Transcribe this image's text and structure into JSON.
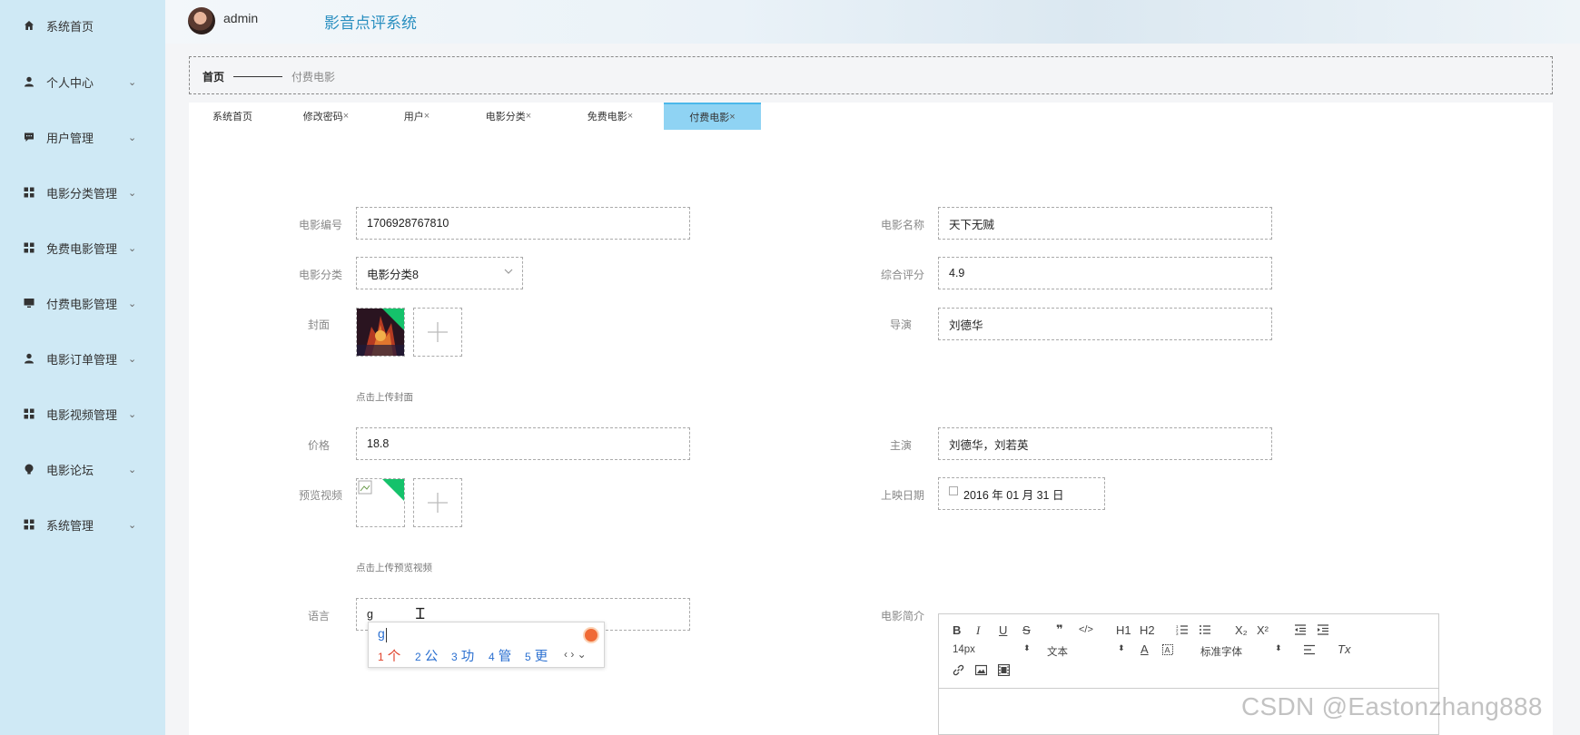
{
  "sidebar": {
    "items": [
      {
        "label": "系统首页",
        "icon": "home-icon",
        "has_chevron": false
      },
      {
        "label": "个人中心",
        "icon": "user-icon",
        "has_chevron": true
      },
      {
        "label": "用户管理",
        "icon": "chat-icon",
        "has_chevron": true
      },
      {
        "label": "电影分类管理",
        "icon": "grid-icon",
        "has_chevron": true
      },
      {
        "label": "免费电影管理",
        "icon": "grid-icon",
        "has_chevron": true
      },
      {
        "label": "付费电影管理",
        "icon": "monitor-icon",
        "has_chevron": true
      },
      {
        "label": "电影订单管理",
        "icon": "user-icon",
        "has_chevron": true
      },
      {
        "label": "电影视频管理",
        "icon": "grid-icon",
        "has_chevron": true
      },
      {
        "label": "电影论坛",
        "icon": "bulb-icon",
        "has_chevron": true
      },
      {
        "label": "系统管理",
        "icon": "grid-icon",
        "has_chevron": true
      }
    ],
    "chevron": "⌄"
  },
  "header": {
    "username": "admin",
    "system_title": "影音点评系统"
  },
  "breadcrumb": {
    "home": "首页",
    "current": "付费电影"
  },
  "tabs": [
    {
      "label": "系统首页",
      "closable": false,
      "active": false
    },
    {
      "label": "修改密码",
      "closable": true,
      "active": false
    },
    {
      "label": "用户",
      "closable": true,
      "active": false
    },
    {
      "label": "电影分类",
      "closable": true,
      "active": false
    },
    {
      "label": "免费电影",
      "closable": true,
      "active": false
    },
    {
      "label": "付费电影",
      "closable": true,
      "active": true
    }
  ],
  "tab_close": "×",
  "form": {
    "movie_no": {
      "label": "电影编号",
      "value": "1706928767810"
    },
    "movie_name": {
      "label": "电影名称",
      "value": "天下无贼"
    },
    "category": {
      "label": "电影分类",
      "value": "电影分类8"
    },
    "rating": {
      "label": "综合评分",
      "value": "4.9"
    },
    "cover": {
      "label": "封面",
      "hint": "点击上传封面"
    },
    "director": {
      "label": "导演",
      "value": "刘德华"
    },
    "price": {
      "label": "价格",
      "value": "18.8"
    },
    "actors": {
      "label": "主演",
      "value": "刘德华，刘若英"
    },
    "preview_video": {
      "label": "预览视频",
      "hint": "点击上传预览视频"
    },
    "release_date": {
      "label": "上映日期",
      "value": "2016 年 01 月 31 日"
    },
    "language": {
      "label": "语言",
      "value": "g"
    },
    "intro": {
      "label": "电影简介"
    }
  },
  "ime": {
    "composition": "g",
    "candidates": [
      {
        "num": "1",
        "char": "个"
      },
      {
        "num": "2",
        "char": "公"
      },
      {
        "num": "3",
        "char": "功"
      },
      {
        "num": "4",
        "char": "管"
      },
      {
        "num": "5",
        "char": "更"
      }
    ],
    "nav": "‹ › ⌄"
  },
  "editor": {
    "font_size": "14px",
    "text_type": "文本",
    "font_family": "标准字体",
    "buttons": [
      "B",
      "I",
      "U",
      "S",
      "❞",
      "</>",
      "H1",
      "H2",
      "list-ordered",
      "list-bullet",
      "X₂",
      "X²",
      "outdent",
      "indent",
      "A",
      "A-bg",
      "align",
      "Tx",
      "link",
      "image",
      "video"
    ]
  },
  "watermark": "CSDN @Eastonzhang888",
  "colors": {
    "sidebar_bg": "#cfe9f5",
    "active_tab": "#8fd3f3",
    "title_blue": "#2a8fc0",
    "ime_highlight": "#e0412a",
    "upload_corner": "#15c26b"
  }
}
